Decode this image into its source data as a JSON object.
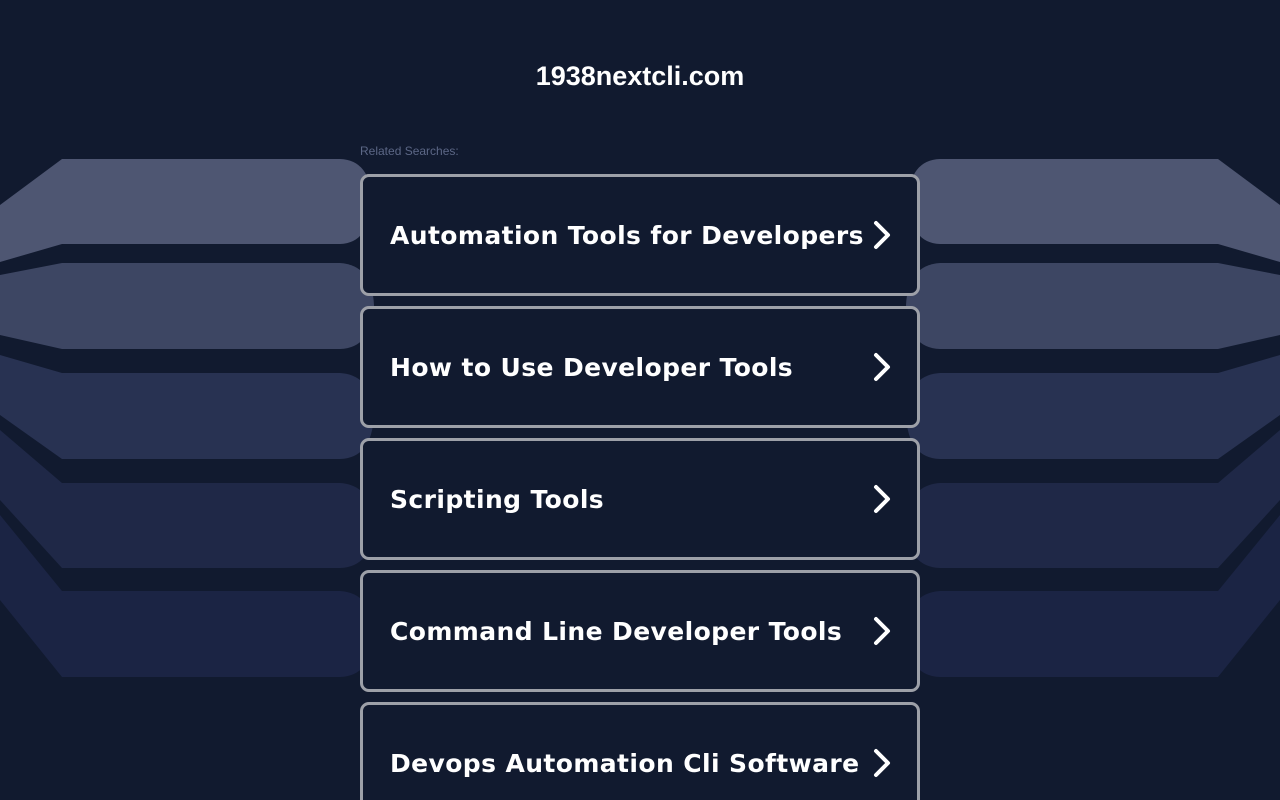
{
  "header": {
    "domain": "1938nextcli.com"
  },
  "related": {
    "label": "Related Searches:",
    "items": [
      {
        "label": "Automation Tools for Developers",
        "icon": "chevron-right-icon"
      },
      {
        "label": "How to Use Developer Tools",
        "icon": "chevron-right-icon"
      },
      {
        "label": "Scripting Tools",
        "icon": "chevron-right-icon"
      },
      {
        "label": "Command Line Developer Tools",
        "icon": "chevron-right-icon"
      },
      {
        "label": "Devops Automation Cli Software",
        "icon": "chevron-right-icon"
      }
    ]
  },
  "colors": {
    "background": "#111a2f",
    "card_border": "#9da0a8",
    "text": "#ffffff",
    "label": "#5c6786",
    "bg_band_1": "#4e5672",
    "bg_band_2": "#3d4663",
    "bg_band_3": "#283252",
    "bg_band_4": "#1f2847",
    "bg_band_5": "#1b2444"
  }
}
